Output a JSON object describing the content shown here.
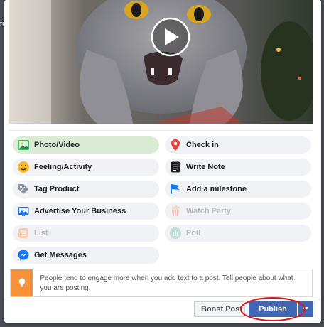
{
  "background": {
    "sliver_text": "ti"
  },
  "video": {
    "play_label": "Play video"
  },
  "options": {
    "photo_video": "Photo/Video",
    "check_in": "Check in",
    "feeling_activity": "Feeling/Activity",
    "write_note": "Write Note",
    "tag_product": "Tag Product",
    "add_milestone": "Add a milestone",
    "advertise_business": "Advertise Your Business",
    "watch_party": "Watch Party",
    "list": "List",
    "poll": "Poll",
    "get_messages": "Get Messages"
  },
  "tip": {
    "text": "People tend to engage more when you add text to a post. Tell people about what you are posting."
  },
  "footer": {
    "boost_label": "Boost Post",
    "publish_label": "Publish"
  },
  "colors": {
    "publish": "#4267b2",
    "selected_option": "#dbecd5",
    "tip_accent": "#f7923a",
    "annotation_ring": "#e0161b"
  }
}
